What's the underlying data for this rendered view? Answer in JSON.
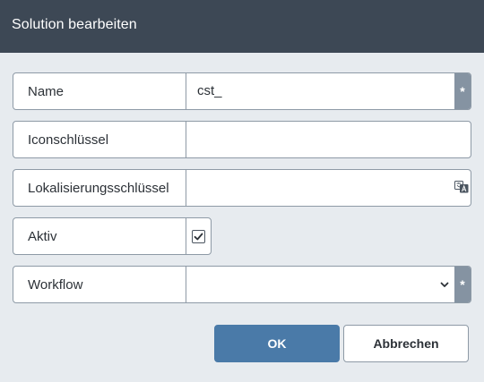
{
  "dialog": {
    "title": "Solution bearbeiten"
  },
  "form": {
    "name": {
      "label": "Name",
      "value": "cst_",
      "required_mark": "*"
    },
    "icon_key": {
      "label": "Iconschlüssel",
      "value": ""
    },
    "localization_key": {
      "label": "Lokalisierungsschlüssel",
      "value": "",
      "icon": "translate-icon"
    },
    "active": {
      "label": "Aktiv",
      "checked": true
    },
    "workflow": {
      "label": "Workflow",
      "value": "",
      "required_mark": "*",
      "icon": "chevron-down-icon"
    }
  },
  "buttons": {
    "ok_label": "OK",
    "cancel_label": "Abbrechen"
  },
  "colors": {
    "titlebar": "#3d4855",
    "background": "#e7ebef",
    "primary": "#4a7aa8",
    "required_badge": "#8593a2",
    "border": "#8e9aa6"
  }
}
